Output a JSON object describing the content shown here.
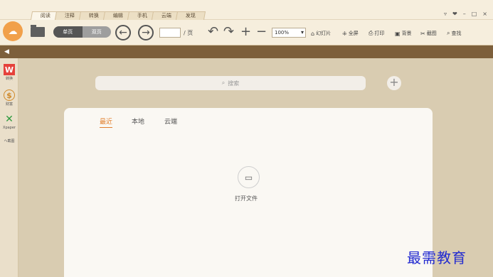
{
  "app": {
    "logo_icon": "app-logo-icon",
    "tabs": [
      "阅读",
      "注释",
      "转换",
      "编辑",
      "手机",
      "云端",
      "发现"
    ],
    "active_tab": "阅读",
    "window_controls": [
      "▿",
      "❤",
      "–",
      "□",
      "×"
    ]
  },
  "toolbar": {
    "open_folder_icon": "folder-icon",
    "view_modes": [
      "单页",
      "双页"
    ],
    "active_view_mode": "单页",
    "prev_icon": "←",
    "next_icon": "→",
    "page_value": "",
    "page_suffix": "/ 页",
    "undo_icon": "↶",
    "redo_icon": "↷",
    "zoom_in_icon": "+",
    "zoom_out_icon": "−",
    "zoom_value": "100%",
    "tools": [
      {
        "icon": "⌂",
        "label": "幻灯片"
      },
      {
        "icon": "⁜",
        "label": "全屏"
      },
      {
        "icon": "⎙",
        "label": "打印"
      },
      {
        "icon": "▣",
        "label": "背景"
      },
      {
        "icon": "✂",
        "label": "截图"
      },
      {
        "icon": "⌕",
        "label": "查找"
      }
    ]
  },
  "strip": {
    "icon": "◀"
  },
  "sidebar": {
    "items": [
      {
        "label": "转换"
      },
      {
        "label": "财富"
      },
      {
        "label": "Xpaper"
      },
      {
        "label": "ヘ截图"
      }
    ]
  },
  "main": {
    "search_placeholder": "搜索",
    "tabs": [
      "最近",
      "本地",
      "云端"
    ],
    "active_tab": "最近",
    "open_file_label": "打开文件"
  },
  "watermark": "最需教育",
  "colors": {
    "accent": "#e17f2d",
    "strip": "#7d5f3b",
    "logo": "#f1a04a"
  }
}
